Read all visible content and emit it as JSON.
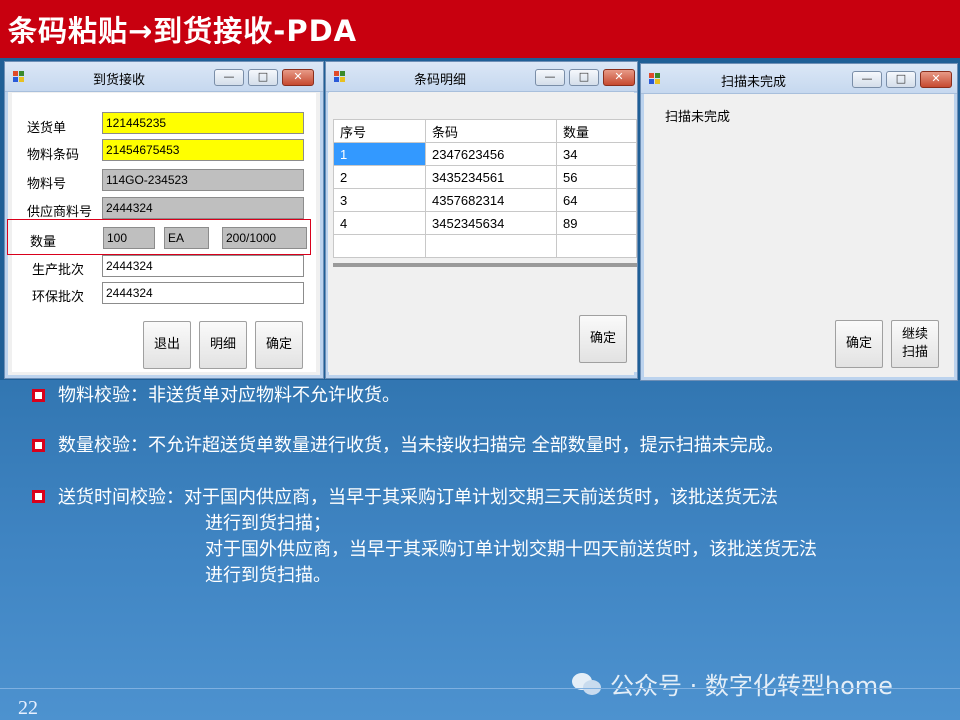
{
  "slide": {
    "title": "条码粘贴→到货接收-PDA",
    "page_number": "22",
    "watermark": "公众号 · 数字化转型home"
  },
  "window_receive": {
    "title": "到货接收",
    "labels": {
      "delivery_no": "送货单",
      "material_barcode": "物料条码",
      "material_no": "物料号",
      "supplier_material_no": "供应商料号",
      "quantity": "数量",
      "production_batch": "生产批次",
      "env_batch": "环保批次"
    },
    "values": {
      "delivery_no": "121445235",
      "material_barcode": "21454675453",
      "material_no": "114GO-234523",
      "supplier_material_no": "2444324",
      "quantity": "100",
      "unit": "EA",
      "progress": "200/1000",
      "production_batch": "2444324",
      "env_batch": "2444324"
    },
    "buttons": {
      "exit": "退出",
      "detail": "明细",
      "confirm": "确定"
    }
  },
  "window_detail": {
    "title": "条码明细",
    "columns": [
      "序号",
      "条码",
      "数量"
    ],
    "rows": [
      [
        "1",
        "2347623456",
        "34"
      ],
      [
        "2",
        "3435234561",
        "56"
      ],
      [
        "3",
        "4357682314",
        "64"
      ],
      [
        "4",
        "3452345634",
        "89"
      ]
    ],
    "confirm": "确定"
  },
  "window_incomplete": {
    "title": "扫描未完成",
    "message": "扫描未完成",
    "confirm": "确定",
    "continue_line1": "继续",
    "continue_line2": "扫描"
  },
  "bullets": [
    {
      "lines": [
        "物料校验：非送货单对应物料不允许收货。"
      ]
    },
    {
      "lines": [
        "数量校验：不允许超送货单数量进行收货，当未接收扫描完 全部数量时，提示扫描未完成。"
      ]
    },
    {
      "lines": [
        "送货时间校验：对于国内供应商，当早于其采购订单计划交期三天前送货时，该批送货无法",
        "进行到货扫描；",
        "对于国外供应商，当早于其采购订单计划交期十四天前送货时，该批送货无法",
        "进行到货扫描。"
      ]
    }
  ],
  "colors": {
    "title_bar": "#c8000f",
    "background": "#2a6ea8",
    "highlight_field": "#ffff00",
    "readonly_field": "#bfbfbf",
    "selected_cell": "#3399ff"
  }
}
